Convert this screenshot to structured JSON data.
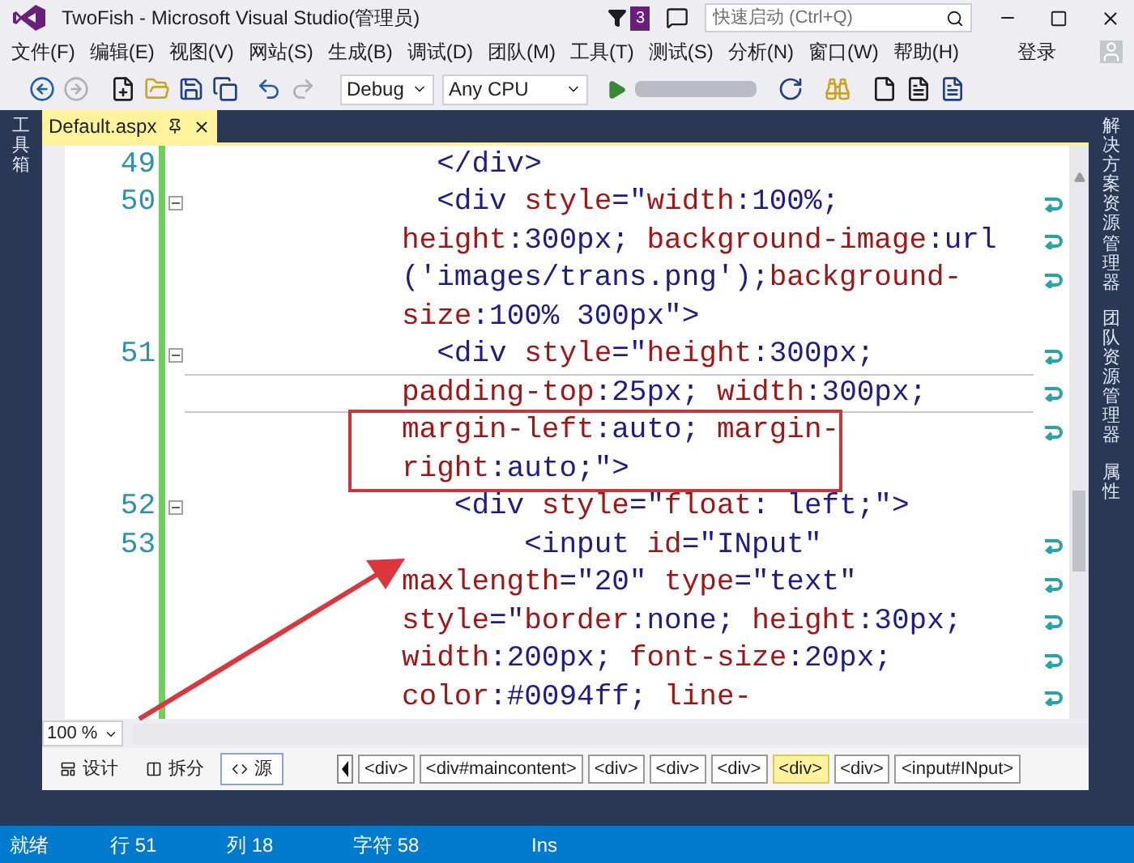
{
  "window": {
    "title": "TwoFish - Microsoft Visual Studio(管理员)",
    "notification_count": "3",
    "quick_launch": {
      "placeholder": "快速启动 (Ctrl+Q)"
    }
  },
  "menu": {
    "items": [
      "文件(F)",
      "编辑(E)",
      "视图(V)",
      "网站(S)",
      "生成(B)",
      "调试(D)",
      "团队(M)",
      "工具(T)",
      "测试(S)",
      "分析(N)",
      "窗口(W)",
      "帮助(H)"
    ],
    "sign_in": "登录"
  },
  "toolbar": {
    "configuration": "Debug",
    "platform": "Any CPU"
  },
  "left_panel": {
    "label": "工具箱"
  },
  "right_panel": {
    "tabs": [
      "解决方案资源管理器",
      "团队资源管理器",
      "属性"
    ]
  },
  "document_tab": {
    "title": "Default.aspx"
  },
  "editor": {
    "lines": [
      {
        "number": "49",
        "collapsible": false,
        "rows": [
          {
            "text": "  </div>",
            "wrap": false,
            "current": false,
            "boxed": false
          }
        ]
      },
      {
        "number": "50",
        "collapsible": true,
        "rows": [
          {
            "text": "  <div style=\"width:100%;",
            "wrap": true,
            "current": false,
            "boxed": false
          },
          {
            "text": "height:300px; background-image:url",
            "wrap": true,
            "current": false,
            "boxed": false
          },
          {
            "text": "('images/trans.png');background-",
            "wrap": true,
            "current": false,
            "boxed": false
          },
          {
            "text": "size:100% 300px\">",
            "wrap": false,
            "current": false,
            "boxed": false
          }
        ]
      },
      {
        "number": "51",
        "collapsible": true,
        "rows": [
          {
            "text": "  <div style=\"height:300px;",
            "wrap": true,
            "current": false,
            "boxed": false
          },
          {
            "text": "padding-top:25px; width:300px;",
            "wrap": true,
            "current": true,
            "boxed": false
          },
          {
            "text": "margin-left:auto; margin-",
            "wrap": true,
            "current": false,
            "boxed": true
          },
          {
            "text": "right:auto;\">",
            "wrap": false,
            "current": false,
            "boxed": true
          }
        ]
      },
      {
        "number": "52",
        "collapsible": true,
        "rows": [
          {
            "text": "   <div style=\"float: left;\">",
            "wrap": false,
            "current": false,
            "boxed": false
          }
        ]
      },
      {
        "number": "53",
        "collapsible": false,
        "rows": [
          {
            "text": "       <input id=\"INput\"",
            "wrap": true,
            "current": false,
            "boxed": false
          },
          {
            "text": "maxlength=\"20\" type=\"text\"",
            "wrap": true,
            "current": false,
            "boxed": false
          },
          {
            "text": "style=\"border:none; height:30px;",
            "wrap": true,
            "current": false,
            "boxed": false
          },
          {
            "text": "width:200px; font-size:20px;",
            "wrap": true,
            "current": false,
            "boxed": false
          },
          {
            "text": "color:#0094ff; line-",
            "wrap": true,
            "current": false,
            "boxed": false
          }
        ]
      }
    ]
  },
  "zoom": "100 %",
  "view_modes": [
    {
      "label": "设计",
      "selected": false
    },
    {
      "label": "拆分",
      "selected": false
    },
    {
      "label": "源",
      "selected": true
    }
  ],
  "breadcrumbs": [
    {
      "label": "<div>",
      "selected": false
    },
    {
      "label": "<div#maincontent>",
      "selected": false
    },
    {
      "label": "<div>",
      "selected": false
    },
    {
      "label": "<div>",
      "selected": false
    },
    {
      "label": "<div>",
      "selected": false
    },
    {
      "label": "<div>",
      "selected": true
    },
    {
      "label": "<div>",
      "selected": false
    },
    {
      "label": "<input#INput>",
      "selected": false
    }
  ],
  "status_bar": {
    "state": "就绪",
    "line": "行 51",
    "column": "列 18",
    "char": "字符 58",
    "mode": "Ins"
  }
}
